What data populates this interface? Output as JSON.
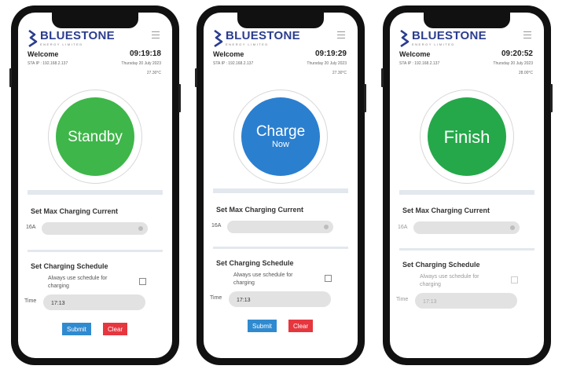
{
  "brand": {
    "name": "BLUESTONE",
    "tagline": "ENERGY LIMITED",
    "color": "#2b3d8f"
  },
  "colors": {
    "standby": "#3eb649",
    "charge": "#2b7fcf",
    "finish": "#25a84a",
    "submit": "#2f8ad0",
    "clear": "#e6363e"
  },
  "phones": [
    {
      "welcome": "Welcome",
      "time": "09:19:18",
      "sta": "STA IP : 192.168.2.137",
      "date": "Thursday 20 July 2023",
      "temp": "27.30°C",
      "status_line1": "Standby",
      "status_line2": "",
      "status_color": "#3eb649",
      "current_title": "Set Max Charging Current",
      "current_value": "16A",
      "schedule_title": "Set Charging Schedule",
      "schedule_check_label": "Always use schedule for charging",
      "time_label": "Time",
      "time_value": "17:13",
      "submit_label": "Submit",
      "clear_label": "Clear"
    },
    {
      "welcome": "Welcome",
      "time": "09:19:29",
      "sta": "STA IP : 192.168.2.137",
      "date": "Thursday 20 July 2023",
      "temp": "27.30°C",
      "status_line1": "Charge",
      "status_line2": "Now",
      "status_color": "#2b7fcf",
      "current_title": "Set Max Charging Current",
      "current_value": "16A",
      "schedule_title": "Set Charging Schedule",
      "schedule_check_label": "Always use schedule for charging",
      "time_label": "Time",
      "time_value": "17:13",
      "submit_label": "Submit",
      "clear_label": "Clear"
    },
    {
      "welcome": "Welcome",
      "time": "09:20:52",
      "sta": "STA IP : 192.168.2.137",
      "date": "Thursday 20 July 2023",
      "temp": "28.00°C",
      "status_line1": "Finish",
      "status_line2": "",
      "status_color": "#25a84a",
      "current_title": "Set Max Charging Current",
      "current_value": "16A",
      "schedule_title": "Set Charging Schedule",
      "schedule_check_label": "Always use schedule for charging",
      "time_label": "Time",
      "time_value": "17:13"
    }
  ]
}
